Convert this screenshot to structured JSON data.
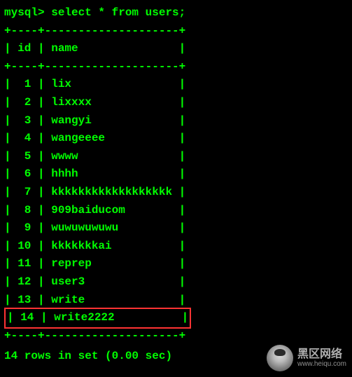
{
  "prompt": "mysql> select * from users;",
  "border_top": "+----+--------------------+",
  "header_line": "| id | name               |",
  "border_mid": "+----+--------------------+",
  "border_bottom": "+----+--------------------+",
  "rows": [
    {
      "id": 1,
      "name": "lix"
    },
    {
      "id": 2,
      "name": "lixxxx"
    },
    {
      "id": 3,
      "name": "wangyi"
    },
    {
      "id": 4,
      "name": "wangeeee"
    },
    {
      "id": 5,
      "name": "wwww"
    },
    {
      "id": 6,
      "name": "hhhh"
    },
    {
      "id": 7,
      "name": "kkkkkkkkkkkkkkkkkk"
    },
    {
      "id": 8,
      "name": "909baiducom"
    },
    {
      "id": 9,
      "name": "wuwuwuwuwu"
    },
    {
      "id": 10,
      "name": "kkkkkkkai"
    },
    {
      "id": 11,
      "name": "reprep"
    },
    {
      "id": 12,
      "name": "user3"
    },
    {
      "id": 13,
      "name": "write"
    },
    {
      "id": 14,
      "name": "write2222"
    }
  ],
  "highlight_index": 13,
  "summary": "14 rows in set (0.00 sec)",
  "chart_data": {
    "type": "table",
    "title": "users",
    "columns": [
      "id",
      "name"
    ],
    "rows": [
      [
        1,
        "lix"
      ],
      [
        2,
        "lixxxx"
      ],
      [
        3,
        "wangyi"
      ],
      [
        4,
        "wangeeee"
      ],
      [
        5,
        "wwww"
      ],
      [
        6,
        "hhhh"
      ],
      [
        7,
        "kkkkkkkkkkkkkkkkkk"
      ],
      [
        8,
        "909baiducom"
      ],
      [
        9,
        "wuwuwuwuwu"
      ],
      [
        10,
        "kkkkkkkai"
      ],
      [
        11,
        "reprep"
      ],
      [
        12,
        "user3"
      ],
      [
        13,
        "write"
      ],
      [
        14,
        "write2222"
      ]
    ]
  },
  "watermark": {
    "main": "黑区网络",
    "sub": "www.heiqu.com"
  }
}
